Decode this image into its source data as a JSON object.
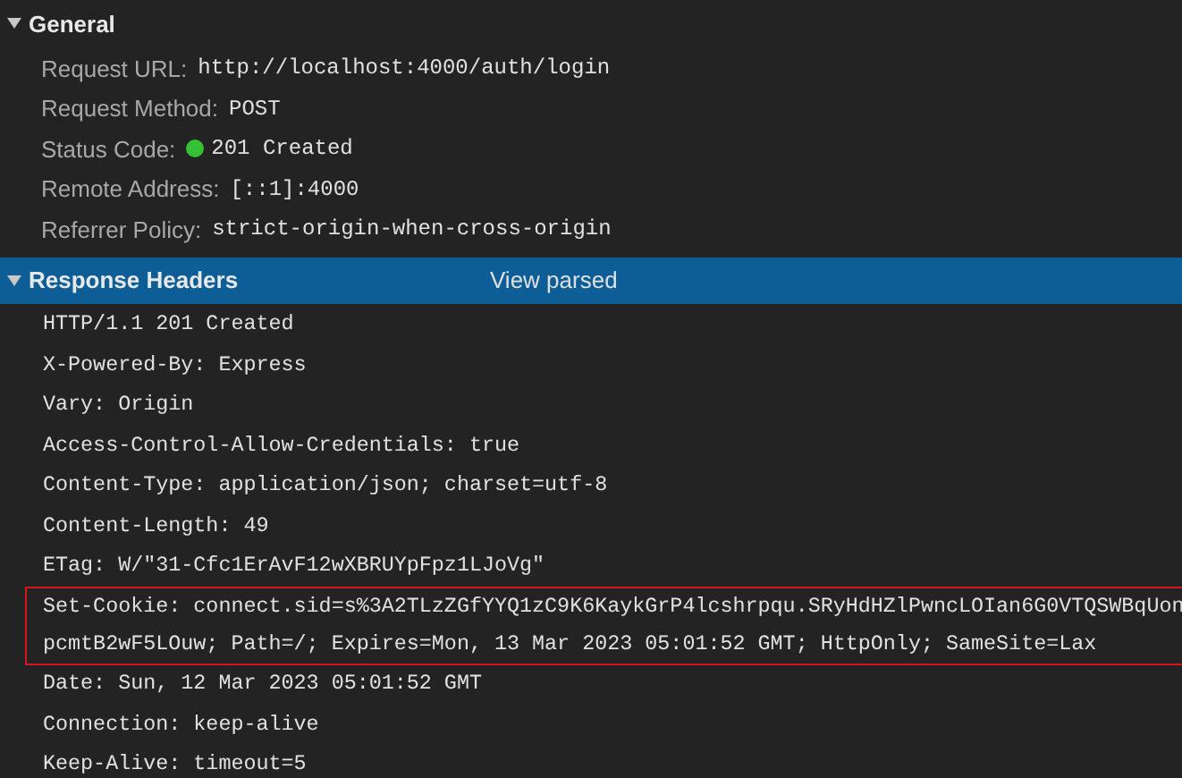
{
  "sections": [
    {
      "title": "General",
      "expanded": true,
      "selected": false,
      "kind": "fields",
      "fields": [
        {
          "label": "Request URL:",
          "value": "http://localhost:4000/auth/login",
          "status_dot": false
        },
        {
          "label": "Request Method:",
          "value": "POST",
          "status_dot": false
        },
        {
          "label": "Status Code:",
          "value": "201 Created",
          "status_dot": true
        },
        {
          "label": "Remote Address:",
          "value": "[::1]:4000",
          "status_dot": false
        },
        {
          "label": "Referrer Policy:",
          "value": "strict-origin-when-cross-origin",
          "status_dot": false
        }
      ]
    },
    {
      "title": "Response Headers",
      "expanded": true,
      "selected": true,
      "kind": "raw",
      "action": "View parsed",
      "lines": [
        {
          "text": "HTTP/1.1 201 Created",
          "highlighted": false
        },
        {
          "text": "X-Powered-By: Express",
          "highlighted": false
        },
        {
          "text": "Vary: Origin",
          "highlighted": false
        },
        {
          "text": "Access-Control-Allow-Credentials: true",
          "highlighted": false
        },
        {
          "text": "Content-Type: application/json; charset=utf-8",
          "highlighted": false
        },
        {
          "text": "Content-Length: 49",
          "highlighted": false
        },
        {
          "text": "ETag: W/\"31-Cfc1ErAvF12wXBRUYpFpz1LJoVg\"",
          "highlighted": false
        },
        {
          "text": "Set-Cookie: connect.sid=s%3A2TLzZGfYYQ1zC9K6KaykGrP4lcshrpqu.SRyHdHZlPwncLOIan6G0VTQSWBqUonpcmtB2wF5LOuw; Path=/; Expires=Mon, 13 Mar 2023 05:01:52 GMT; HttpOnly; SameSite=Lax",
          "highlighted": true
        },
        {
          "text": "Date: Sun, 12 Mar 2023 05:01:52 GMT",
          "highlighted": false
        },
        {
          "text": "Connection: keep-alive",
          "highlighted": false
        },
        {
          "text": "Keep-Alive: timeout=5",
          "highlighted": false
        }
      ]
    }
  ]
}
